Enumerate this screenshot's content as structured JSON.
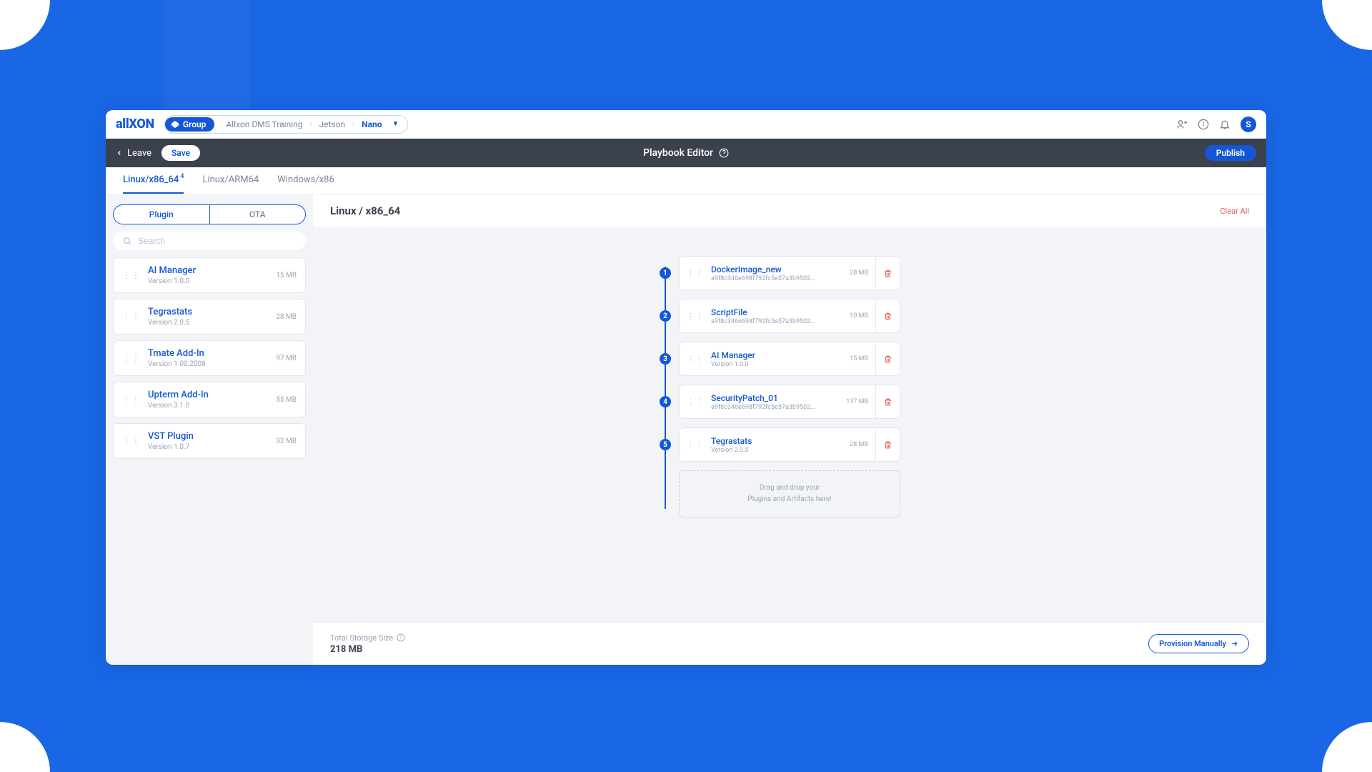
{
  "logo": "allXON",
  "breadcrumb": {
    "group_label": "Group",
    "items": [
      "Allxon DMS Training",
      "Jetson",
      "Nano"
    ]
  },
  "avatar_initial": "S",
  "titlebar": {
    "leave": "Leave",
    "save": "Save",
    "title": "Playbook Editor",
    "publish": "Publish"
  },
  "tabs": [
    {
      "label": "Linux/x86_64",
      "active": true,
      "sup": "4"
    },
    {
      "label": "Linux/ARM64",
      "active": false
    },
    {
      "label": "Windows/x86",
      "active": false
    }
  ],
  "sidebar": {
    "seg": {
      "plugin": "Plugin",
      "ota": "OTA"
    },
    "search_placeholder": "Search",
    "plugins": [
      {
        "name": "AI Manager",
        "version": "Version 1.0.0",
        "size": "15 MB"
      },
      {
        "name": "Tegrastats",
        "version": "Version 2.0.5",
        "size": "28 MB"
      },
      {
        "name": "Tmate Add-In",
        "version": "Version 1.00.2008",
        "size": "97 MB"
      },
      {
        "name": "Upterm Add-In",
        "version": "Version 3.1.0",
        "size": "55 MB"
      },
      {
        "name": "VST Plugin",
        "version": "Version 1.0.7",
        "size": "32 MB"
      }
    ]
  },
  "main": {
    "title": "Linux / x86_64",
    "clear_all": "Clear All",
    "steps": [
      {
        "name": "DockerImage_new",
        "sub": "a9f8c346e698f792fc5e57a3b9502...",
        "size": "28 MB"
      },
      {
        "name": "ScriptFile",
        "sub": "a9f8c346e698f792fc5e57a3b9502...",
        "size": "10 MB"
      },
      {
        "name": "AI Manager",
        "sub": "Version 1.0.0",
        "size": "15 MB"
      },
      {
        "name": "SecurityPatch_01",
        "sub": "a9f8c346e698f792fc5e57a3b9502...",
        "size": "137 MB"
      },
      {
        "name": "Tegrastats",
        "sub": "Version 2.0.5",
        "size": "28 MB"
      }
    ],
    "dropzone_line1": "Drag and drop your",
    "dropzone_line2": "Plugins and Artifacts here!"
  },
  "footer": {
    "label": "Total Storage Size",
    "value": "218 MB",
    "provision": "Provision Manually"
  }
}
